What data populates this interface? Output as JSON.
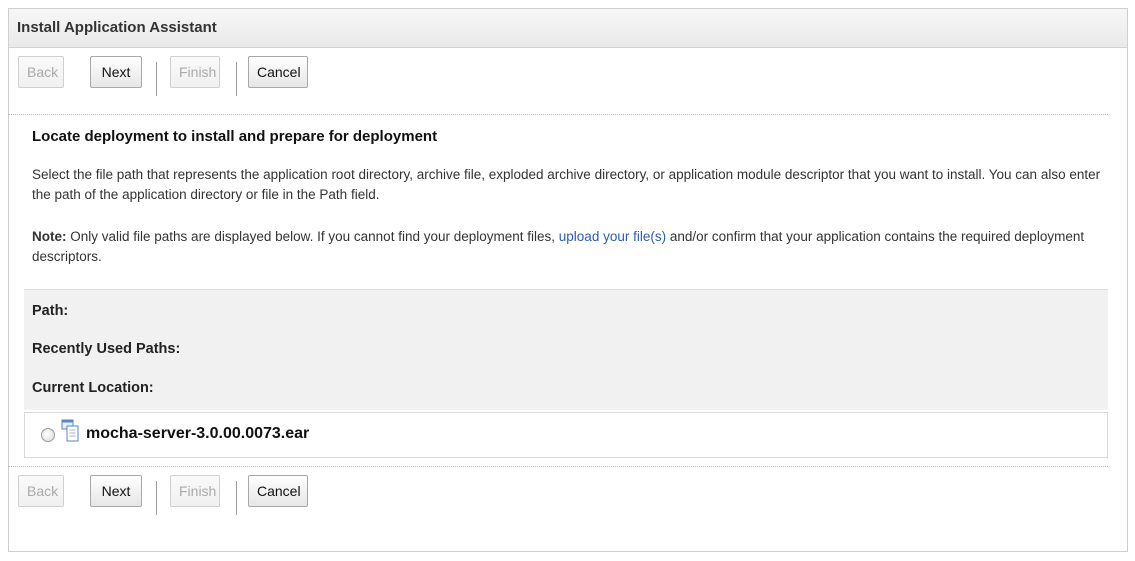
{
  "panel": {
    "title": "Install Application Assistant"
  },
  "toolbar": {
    "back_label": "Back",
    "next_label": "Next",
    "finish_label": "Finish",
    "cancel_label": "Cancel"
  },
  "section": {
    "title": "Locate deployment to install and prepare for deployment",
    "description": "Select the file path that represents the application root directory, archive file, exploded archive directory, or application module descriptor that you want to install. You can also enter the path of the application directory or file in the Path field.",
    "note_label": "Note:",
    "note_before_link": " Only valid file paths are displayed below. If you cannot find your deployment files, ",
    "note_link": "upload your file(s)",
    "note_after_link": " and/or confirm that your application contains the required deployment descriptors."
  },
  "fields": {
    "path_label": "Path:",
    "recent_label": "Recently Used Paths:",
    "current_label": "Current Location:"
  },
  "files": [
    {
      "name": "mocha-server-3.0.00.0073.ear",
      "icon": "archive-file-icon",
      "selected": false
    }
  ],
  "colors": {
    "link": "#2a5db0",
    "header_bg": "#ececec",
    "fields_bg": "#f1f1f1"
  }
}
